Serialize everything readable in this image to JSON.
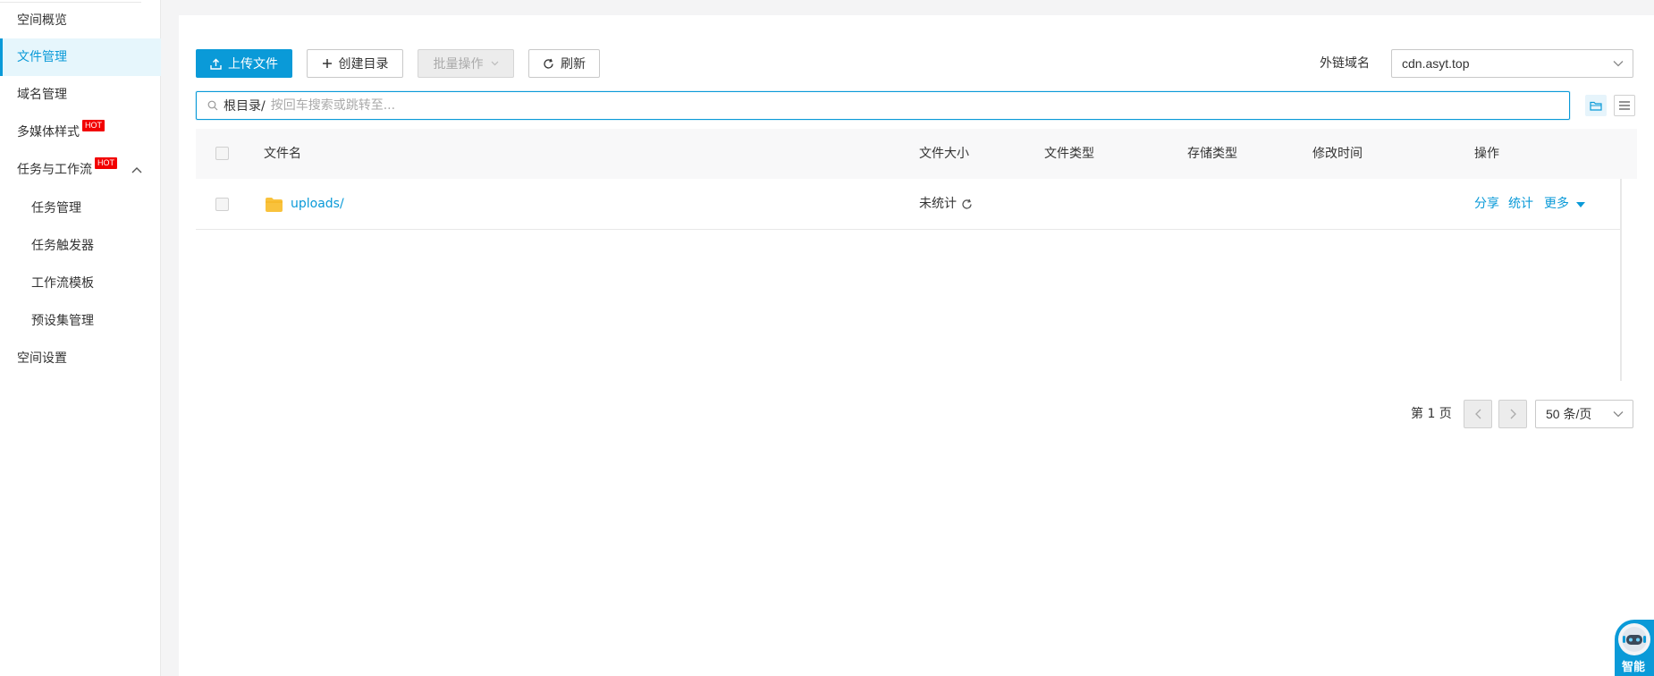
{
  "sidebar": {
    "items": [
      {
        "label": "空间概览"
      },
      {
        "label": "文件管理"
      },
      {
        "label": "域名管理"
      },
      {
        "label": "多媒体样式",
        "badge": "HOT"
      },
      {
        "label": "任务与工作流",
        "badge": "HOT"
      },
      {
        "label": "任务管理"
      },
      {
        "label": "任务触发器"
      },
      {
        "label": "工作流模板"
      },
      {
        "label": "预设集管理"
      },
      {
        "label": "空间设置"
      }
    ],
    "active_index": 1
  },
  "toolbar": {
    "upload_label": "上传文件",
    "mkdir_label": "创建目录",
    "batch_label": "批量操作",
    "refresh_label": "刷新",
    "domain_label": "外链域名",
    "domain_value": "cdn.asyt.top"
  },
  "search": {
    "prefix": "根目录/",
    "placeholder": "按回车搜索或跳转至..."
  },
  "table": {
    "headers": {
      "name": "文件名",
      "size": "文件大小",
      "type": "文件类型",
      "storage": "存储类型",
      "modified": "修改时间",
      "actions": "操作"
    },
    "rows": [
      {
        "name": "uploads/",
        "size": "未统计",
        "type": "",
        "storage": "",
        "modified": "",
        "actions": [
          "分享",
          "统计",
          "更多"
        ]
      }
    ]
  },
  "pagination": {
    "page_label": "第 1 页",
    "page_size": "50 条/页"
  },
  "assistant": {
    "label": "智能"
  },
  "colors": {
    "accent": "#0a9ad8",
    "hot_badge": "#f20000",
    "folder": "#f9c23c"
  },
  "icons": [
    "upload-icon",
    "plus-icon",
    "chevron-down-icon",
    "refresh-icon",
    "search-icon",
    "folder-view-icon",
    "list-view-icon",
    "folder-icon",
    "caret-down-icon",
    "chevron-left-icon",
    "chevron-right-icon",
    "chevron-up-icon",
    "robot-icon"
  ]
}
